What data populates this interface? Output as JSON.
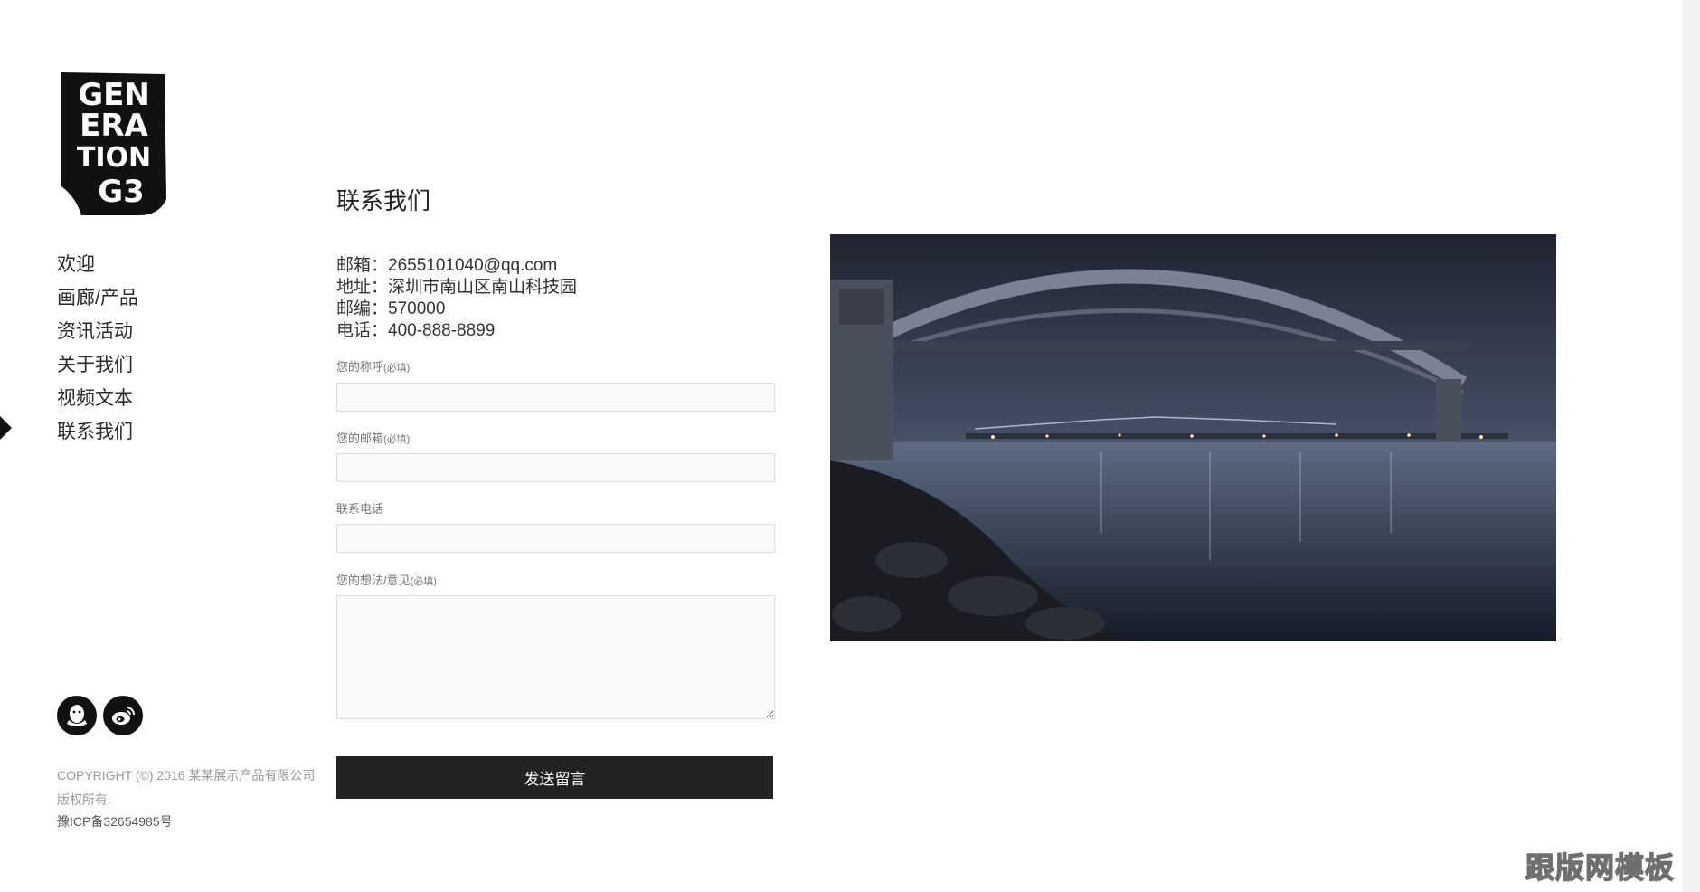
{
  "sidebar": {
    "logo": {
      "lines": [
        "GEN",
        "ERA",
        "TION",
        "G3"
      ]
    },
    "nav": [
      "欢迎",
      "画廊/产品",
      "资讯活动",
      "关于我们",
      "视频文本",
      "联系我们"
    ],
    "active_item": "联系我们",
    "social": [
      {
        "icon": "qq-icon"
      },
      {
        "icon": "weibo-icon"
      }
    ],
    "copyright": "COPYRIGHT (©) 2016 某某展示产品有限公司 版权所有.",
    "icp": "豫ICP备32654985号"
  },
  "main": {
    "title": "联系我们",
    "info": {
      "email": "邮箱：2655101040@qq.com",
      "address": "地址：深圳市南山区南山科技园",
      "postcode": "邮编：570000",
      "phone": "电话：400-888-8899"
    },
    "form": {
      "name_label": "您的称呼",
      "name_req": "(必填)",
      "email_label": "您的邮箱",
      "email_req": "(必填)",
      "phone_label": "联系电话",
      "message_label": "您的想法/意见",
      "message_req": "(必填)",
      "name_value": "",
      "email_value": "",
      "phone_value": "",
      "message_value": "",
      "submit_label": "发送留言"
    }
  },
  "watermark": "跟版网模板",
  "colors": {
    "text": "#222222",
    "button": "#222222",
    "field_bg": "#fafafa",
    "field_border": "#dddddd"
  }
}
